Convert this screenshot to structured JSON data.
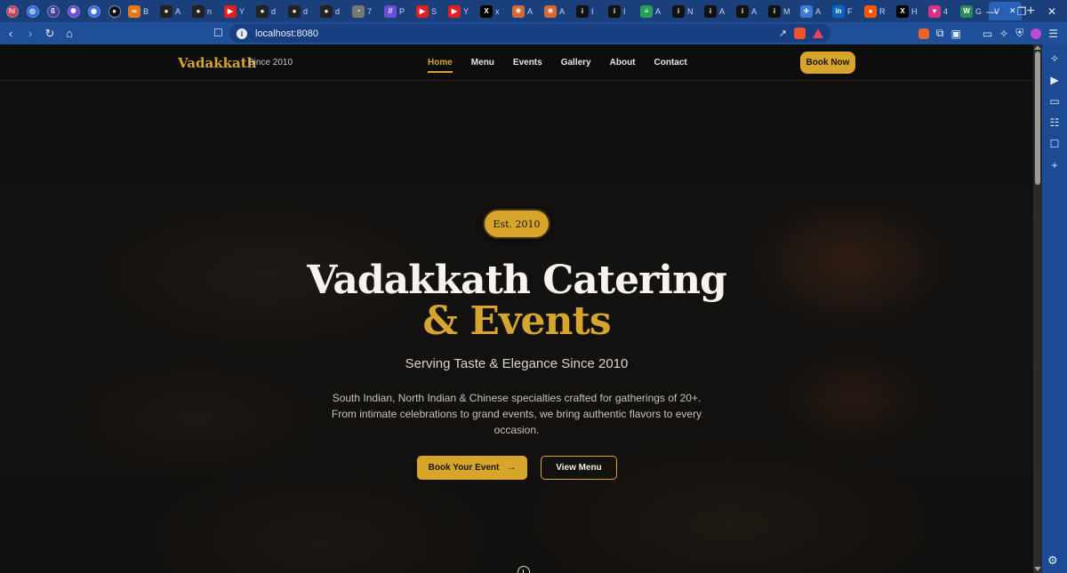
{
  "browser": {
    "tabs": [
      {
        "label": "",
        "icon": "hi-icon",
        "letter": "hi",
        "color": "#e0334c",
        "pinned": true
      },
      {
        "label": "",
        "icon": "blue-circle-icon",
        "letter": "◎",
        "color": "#2d6ad8",
        "pinned": true
      },
      {
        "label": "",
        "icon": "b-icon",
        "letter": "ß",
        "color": "#4a3a99",
        "pinned": true
      },
      {
        "label": "",
        "icon": "purple-icon",
        "letter": "✺",
        "color": "#7a3de0",
        "pinned": true
      },
      {
        "label": "",
        "icon": "blue-circle-icon",
        "letter": "◉",
        "color": "#2f6fe0",
        "pinned": true
      },
      {
        "label": "",
        "icon": "github-icon",
        "letter": "●",
        "color": "#111111",
        "pinned": true
      },
      {
        "label": "B",
        "icon": "infinity-icon",
        "letter": "∞",
        "color": "#e07a20"
      },
      {
        "label": "A",
        "icon": "github-icon",
        "letter": "●",
        "color": "#222222"
      },
      {
        "label": "n",
        "icon": "github-icon",
        "letter": "●",
        "color": "#222222"
      },
      {
        "label": "Y",
        "icon": "youtube-icon",
        "letter": "▶",
        "color": "#e02020"
      },
      {
        "label": "d",
        "icon": "github-icon",
        "letter": "●",
        "color": "#222222"
      },
      {
        "label": "d",
        "icon": "github-icon",
        "letter": "●",
        "color": "#222222"
      },
      {
        "label": "d",
        "icon": "github-icon",
        "letter": "●",
        "color": "#222222"
      },
      {
        "label": "7",
        "icon": "c-icon",
        "letter": "◔",
        "color": "#777777"
      },
      {
        "label": "P",
        "icon": "p-icon",
        "letter": "//",
        "color": "#6a4fd8"
      },
      {
        "label": "S",
        "icon": "youtube-icon",
        "letter": "▶",
        "color": "#e02020"
      },
      {
        "label": "Y",
        "icon": "youtube-icon",
        "letter": "▶",
        "color": "#e02020"
      },
      {
        "label": "x",
        "icon": "x-icon",
        "letter": "X",
        "color": "#000000"
      },
      {
        "label": "A",
        "icon": "burst-icon",
        "letter": "✳",
        "color": "#d26a3a"
      },
      {
        "label": "A",
        "icon": "burst-icon",
        "letter": "✳",
        "color": "#d26a3a"
      },
      {
        "label": "I",
        "icon": "info-icon",
        "letter": "i",
        "color": "#111111"
      },
      {
        "label": "I",
        "icon": "info-icon",
        "letter": "i",
        "color": "#111111"
      },
      {
        "label": "A",
        "icon": "stack-icon",
        "letter": "≡",
        "color": "#2b9d5a"
      },
      {
        "label": "N",
        "icon": "info-icon",
        "letter": "i",
        "color": "#111111"
      },
      {
        "label": "A",
        "icon": "info-icon",
        "letter": "i",
        "color": "#111111"
      },
      {
        "label": "A",
        "icon": "info-icon",
        "letter": "i",
        "color": "#111111"
      },
      {
        "label": "M",
        "icon": "info-icon",
        "letter": "i",
        "color": "#111111"
      },
      {
        "label": "A",
        "icon": "bird-icon",
        "letter": "✈",
        "color": "#3b7bd6"
      },
      {
        "label": "F",
        "icon": "linkedin-icon",
        "letter": "in",
        "color": "#0a66c2"
      },
      {
        "label": "R",
        "icon": "reddit-icon",
        "letter": "●",
        "color": "#ff5700"
      },
      {
        "label": "H",
        "icon": "x-icon",
        "letter": "X",
        "color": "#000000"
      },
      {
        "label": "4",
        "icon": "heart-icon",
        "letter": "♥",
        "color": "#d63384"
      },
      {
        "label": "G",
        "icon": "w-icon",
        "letter": "W",
        "color": "#2e8b57"
      }
    ],
    "active_tab": {
      "label": "V",
      "close": "✕"
    },
    "new_tab": "+",
    "url": "localhost:8080",
    "window_controls": [
      "—",
      "❐",
      "✕"
    ]
  },
  "site": {
    "logo": "Vadakkath",
    "logo_sub": "Since 2010",
    "nav": [
      "Home",
      "Menu",
      "Events",
      "Gallery",
      "About",
      "Contact"
    ],
    "active_nav": "Home",
    "cta": "Book Now"
  },
  "hero": {
    "badge": "Est. 2010",
    "title_line1": "Vadakkath Catering",
    "title_line2": "& Events",
    "tagline": "Serving Taste & Elegance Since 2010",
    "description": "South Indian, North Indian & Chinese specialties crafted for gatherings of 20+. From intimate celebrations to grand events, we bring authentic flavors to every occasion.",
    "primary_button": "Book Your Event",
    "primary_button_arrow": "→",
    "secondary_button": "View Menu"
  },
  "colors": {
    "accent": "#d8a52b",
    "background": "#0e0d0c",
    "browser_chrome": "#1f4f99"
  }
}
